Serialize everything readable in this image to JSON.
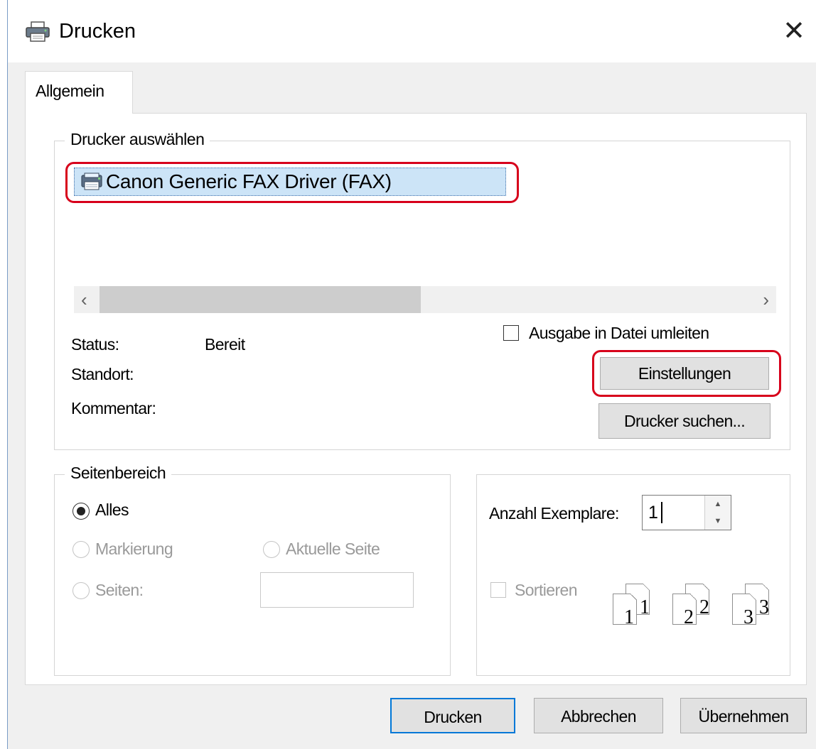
{
  "window": {
    "title": "Drucken",
    "close_glyph": "✕"
  },
  "tabs": [
    {
      "label": "Allgemein",
      "active": true
    }
  ],
  "printer_group": {
    "legend": "Drucker auswählen",
    "printers": [
      {
        "name": "Canon Generic FAX Driver (FAX)",
        "selected": true,
        "icon": "fax-printer-icon"
      }
    ],
    "scroll_left": "‹",
    "scroll_right": "›",
    "status_label": "Status:",
    "status_value": "Bereit",
    "location_label": "Standort:",
    "location_value": "",
    "comment_label": "Kommentar:",
    "comment_value": "",
    "print_to_file_label": "Ausgabe in Datei umleiten",
    "print_to_file_checked": false,
    "settings_button": "Einstellungen",
    "find_printer_button": "Drucker suchen..."
  },
  "page_range": {
    "legend": "Seitenbereich",
    "all_label": "Alles",
    "selection_label": "Markierung",
    "current_page_label": "Aktuelle Seite",
    "pages_label": "Seiten:",
    "pages_value": "",
    "selected": "all"
  },
  "copies": {
    "count_label": "Anzahl Exemplare:",
    "count_value": "1",
    "collate_label": "Sortieren",
    "collate_checked": false,
    "collate_pages": [
      "1",
      "1",
      "2",
      "2",
      "3",
      "3"
    ]
  },
  "footer": {
    "print_button": "Drucken",
    "cancel_button": "Abbrechen",
    "apply_button": "Übernehmen"
  },
  "colors": {
    "highlight": "#d7001b",
    "selection": "#cce4f7",
    "default_button_border": "#0078d7"
  }
}
